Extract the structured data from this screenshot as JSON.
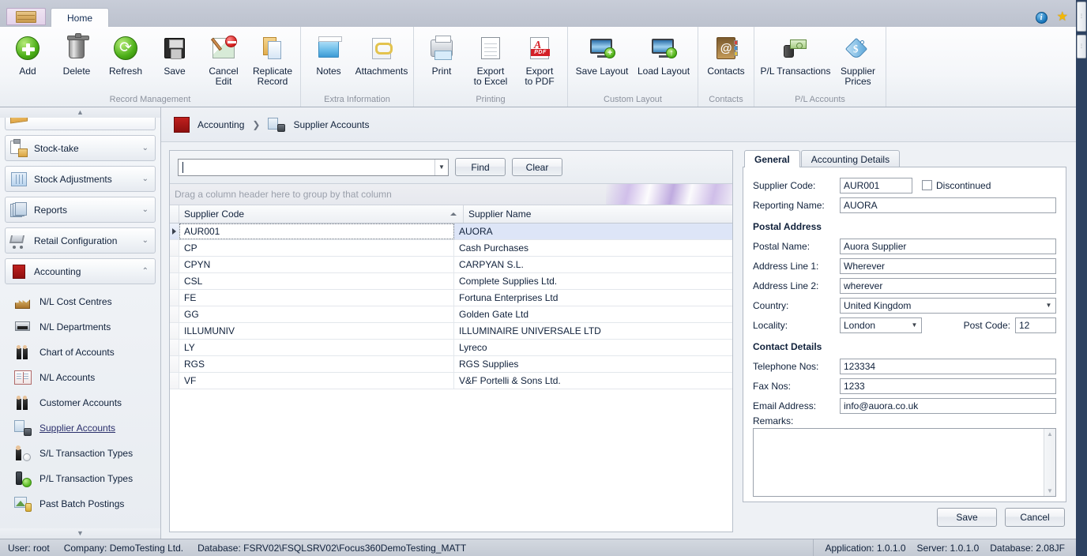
{
  "window": {
    "app_tab_icon": "crate-icon",
    "tabs": [
      {
        "label": "Home",
        "active": true
      }
    ],
    "top_right_icons": [
      "info-icon",
      "favorite-star-icon"
    ]
  },
  "ribbon": {
    "groups": [
      {
        "label": "Record Management",
        "buttons": [
          {
            "label": "Add",
            "icon": "add-icon"
          },
          {
            "label": "Delete",
            "icon": "delete-bin-icon"
          },
          {
            "label": "Refresh",
            "icon": "refresh-icon"
          },
          {
            "label": "Save",
            "icon": "save-floppy-icon"
          },
          {
            "label": "Cancel\nEdit",
            "line1": "Cancel",
            "line2": "Edit",
            "icon": "cancel-edit-icon"
          },
          {
            "label": "Replicate\nRecord",
            "line1": "Replicate",
            "line2": "Record",
            "icon": "replicate-record-icon"
          }
        ]
      },
      {
        "label": "Extra Information",
        "buttons": [
          {
            "label": "Notes",
            "icon": "notes-icon"
          },
          {
            "label": "Attachments",
            "icon": "attachments-icon"
          }
        ]
      },
      {
        "label": "Printing",
        "buttons": [
          {
            "label": "Print",
            "icon": "printer-icon"
          },
          {
            "line1": "Export",
            "line2": "to Excel",
            "icon": "export-excel-icon"
          },
          {
            "line1": "Export",
            "line2": "to PDF",
            "icon": "export-pdf-icon"
          }
        ]
      },
      {
        "label": "Custom Layout",
        "buttons": [
          {
            "label": "Save Layout",
            "icon": "save-layout-icon"
          },
          {
            "label": "Load Layout",
            "icon": "load-layout-icon"
          }
        ]
      },
      {
        "label": "Contacts",
        "buttons": [
          {
            "label": "Contacts",
            "icon": "contacts-book-icon"
          }
        ]
      },
      {
        "label": "P/L Accounts",
        "buttons": [
          {
            "label": "P/L Transactions",
            "icon": "pl-transactions-icon"
          },
          {
            "line1": "Supplier",
            "line2": "Prices",
            "icon": "supplier-prices-tag-icon"
          }
        ]
      }
    ]
  },
  "sidebar": {
    "scroll_up": "▲",
    "scroll_down": "▼",
    "groups": [
      {
        "label": "Stock-take",
        "icon": "stock-take-icon",
        "expanded": false,
        "chevron": "⌄"
      },
      {
        "label": "Stock Adjustments",
        "icon": "stock-adjustments-icon",
        "expanded": false,
        "chevron": "⌄"
      },
      {
        "label": "Reports",
        "icon": "reports-icon",
        "expanded": false,
        "chevron": "⌄"
      },
      {
        "label": "Retail Configuration",
        "icon": "retail-configuration-icon",
        "expanded": false,
        "chevron": "⌄"
      },
      {
        "label": "Accounting",
        "icon": "accounting-icon",
        "expanded": true,
        "chevron": "⌃"
      }
    ],
    "items": [
      {
        "label": "N/L Cost Centres",
        "icon": "nl-cost-centres-icon",
        "active": false
      },
      {
        "label": "N/L Departments",
        "icon": "nl-departments-icon",
        "active": false
      },
      {
        "label": "Chart of Accounts",
        "icon": "chart-of-accounts-icon",
        "active": false
      },
      {
        "label": "N/L Accounts",
        "icon": "nl-accounts-icon",
        "active": false
      },
      {
        "label": "Customer Accounts",
        "icon": "customer-accounts-icon",
        "active": false
      },
      {
        "label": "Supplier Accounts",
        "icon": "supplier-accounts-icon",
        "active": true
      },
      {
        "label": "S/L Transaction Types",
        "icon": "sl-transaction-types-icon",
        "active": false
      },
      {
        "label": "P/L Transaction Types",
        "icon": "pl-transaction-types-icon",
        "active": false
      },
      {
        "label": "Past Batch Postings",
        "icon": "past-batch-postings-icon",
        "active": false
      }
    ]
  },
  "breadcrumb": {
    "root": "Accounting",
    "separator": "❯",
    "current": "Supplier Accounts"
  },
  "find": {
    "value": "",
    "placeholder": "",
    "find_label": "Find",
    "clear_label": "Clear"
  },
  "grid": {
    "group_hint": "Drag a column header here to group by that column",
    "columns": [
      {
        "label": "Supplier Code",
        "sort": "asc"
      },
      {
        "label": "Supplier Name",
        "sort": null
      }
    ],
    "rows": [
      {
        "code": "AUR001",
        "name": "AUORA",
        "selected": true
      },
      {
        "code": "CP",
        "name": "Cash Purchases",
        "selected": false
      },
      {
        "code": "CPYN",
        "name": "CARPYAN S.L.",
        "selected": false
      },
      {
        "code": "CSL",
        "name": "Complete Supplies Ltd.",
        "selected": false
      },
      {
        "code": "FE",
        "name": "Fortuna Enterprises Ltd",
        "selected": false
      },
      {
        "code": "GG",
        "name": "Golden Gate Ltd",
        "selected": false
      },
      {
        "code": "ILLUMUNIV",
        "name": "ILLUMINAIRE UNIVERSALE LTD",
        "selected": false
      },
      {
        "code": "LY",
        "name": "Lyreco",
        "selected": false
      },
      {
        "code": "RGS",
        "name": "RGS Supplies",
        "selected": false
      },
      {
        "code": "VF",
        "name": "V&F Portelli & Sons Ltd.",
        "selected": false
      }
    ]
  },
  "detail": {
    "tabs": [
      {
        "label": "General",
        "active": true
      },
      {
        "label": "Accounting Details",
        "active": false
      }
    ],
    "supplier_code_label": "Supplier Code:",
    "supplier_code_value": "AUR001",
    "discontinued_label": "Discontinued",
    "discontinued_checked": false,
    "reporting_name_label": "Reporting Name:",
    "reporting_name_value": "AUORA",
    "postal_address_heading": "Postal Address",
    "postal_name_label": "Postal Name:",
    "postal_name_value": "Auora Supplier",
    "address1_label": "Address Line 1:",
    "address1_value": "Wherever",
    "address2_label": "Address Line 2:",
    "address2_value": "wherever",
    "country_label": "Country:",
    "country_value": "United Kingdom",
    "locality_label": "Locality:",
    "locality_value": "London",
    "postcode_label": "Post Code:",
    "postcode_value": "12",
    "contact_details_heading": "Contact Details",
    "telephone_label": "Telephone Nos:",
    "telephone_value": "123334",
    "fax_label": "Fax Nos:",
    "fax_value": "1233",
    "email_label": "Email Address:",
    "email_value": "info@auora.co.uk",
    "remarks_label": "Remarks:",
    "remarks_value": "",
    "save_label": "Save",
    "cancel_label": "Cancel"
  },
  "statusbar": {
    "user": "User: root",
    "company": "Company: DemoTesting Ltd.",
    "database": "Database: FSRV02\\FSQLSRV02\\Focus360DemoTesting_MATT",
    "application_version": "Application: 1.0.1.0",
    "server_version": "Server: 1.0.1.0",
    "database_version": "Database: 2.08JF"
  }
}
